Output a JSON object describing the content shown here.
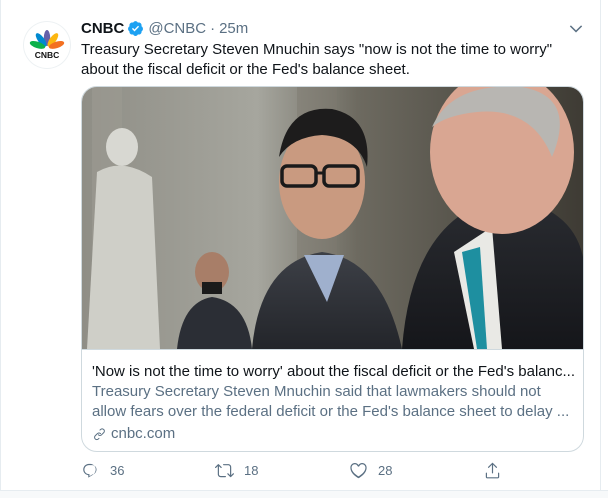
{
  "tweet": {
    "author_name": "CNBC",
    "author_handle": "@CNBC",
    "separator": "·",
    "time": "25m",
    "text": "Treasury Secretary Steven Mnuchin says \"now is not the time to worry\" about the fiscal deficit or the Fed's balance sheet.",
    "avatar_logo_text": "CNBC"
  },
  "card": {
    "title": "'Now is not the time to worry' about the fiscal deficit or the Fed's balanc...",
    "description": "Treasury Secretary Steven Mnuchin said that lawmakers should not allow fears over the federal deficit or the Fed's balance sheet to delay ...",
    "domain": "cnbc.com"
  },
  "actions": {
    "reply_count": "36",
    "retweet_count": "18",
    "like_count": "28"
  },
  "colors": {
    "verified_blue": "#1da1f2",
    "secondary_text": "#5b7083",
    "border": "#cfd9de"
  },
  "icons": [
    "verified-icon",
    "caret-down-icon",
    "link-icon",
    "reply-icon",
    "retweet-icon",
    "like-icon",
    "share-icon"
  ]
}
